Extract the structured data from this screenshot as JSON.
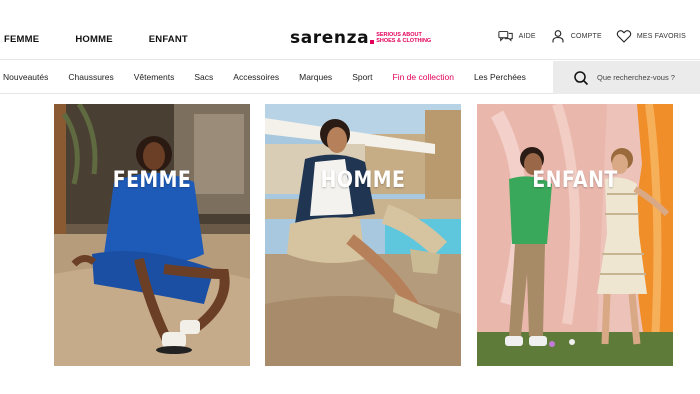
{
  "header": {
    "gender_links": [
      "FEMME",
      "HOMME",
      "ENFANT"
    ],
    "logo": {
      "word": "sarenza",
      "tagline": "SERIOUS ABOUT SHOES & CLOTHING"
    },
    "account_links": {
      "help": "AIDE",
      "account": "COMPTE",
      "favorites": "MES FAVORIS"
    }
  },
  "categories": [
    "Nouveautés",
    "Chaussures",
    "Vêtements",
    "Sacs",
    "Accessoires",
    "Marques",
    "Sport",
    "Fin de collection",
    "Les Perchées"
  ],
  "search": {
    "placeholder": "Que recherchez-vous ?"
  },
  "cards": [
    {
      "label": "FEMME"
    },
    {
      "label": "HOMME"
    },
    {
      "label": "ENFANT"
    }
  ],
  "colors": {
    "brand": "#e2005a",
    "text": "#111111",
    "search_bg": "#ebebeb",
    "sale_category": "#e2005a"
  }
}
